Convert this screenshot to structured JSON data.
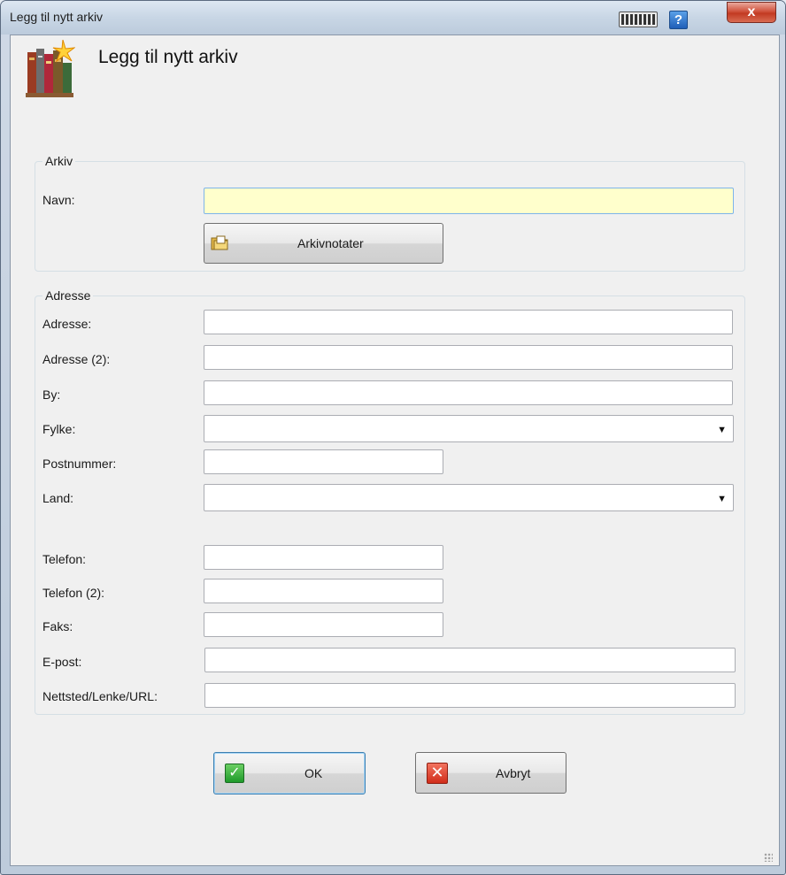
{
  "window": {
    "title": "Legg til nytt arkiv",
    "help_label": "?",
    "close_label": "x"
  },
  "header": {
    "title": "Legg til nytt arkiv"
  },
  "archive_group": {
    "legend": "Arkiv",
    "name_label": "Navn:",
    "name_value": "",
    "notes_button": "Arkivnotater"
  },
  "address_group": {
    "legend": "Adresse",
    "fields": {
      "address": {
        "label": "Adresse:",
        "value": ""
      },
      "address2": {
        "label": "Adresse (2):",
        "value": ""
      },
      "city": {
        "label": "By:",
        "value": ""
      },
      "county": {
        "label": "Fylke:",
        "value": ""
      },
      "postcode": {
        "label": "Postnummer:",
        "value": ""
      },
      "country": {
        "label": "Land:",
        "value": ""
      },
      "phone": {
        "label": "Telefon:",
        "value": ""
      },
      "phone2": {
        "label": "Telefon (2):",
        "value": ""
      },
      "fax": {
        "label": "Faks:",
        "value": ""
      },
      "email": {
        "label": "E-post:",
        "value": ""
      },
      "website": {
        "label": "Nettsted/Lenke/URL:",
        "value": ""
      }
    }
  },
  "footer": {
    "ok_label": "OK",
    "cancel_label": "Avbryt"
  },
  "icons": {
    "ok": "checkmark-icon",
    "cancel": "x-icon",
    "header": "books-icon",
    "notes": "folder-icon",
    "keyboard": "keyboard-icon",
    "help": "help-icon"
  },
  "colors": {
    "focused_field": "#ffffcc",
    "close_button": "#c23a22",
    "ok_icon": "#1f9a2a",
    "cancel_icon": "#d12d1a"
  }
}
